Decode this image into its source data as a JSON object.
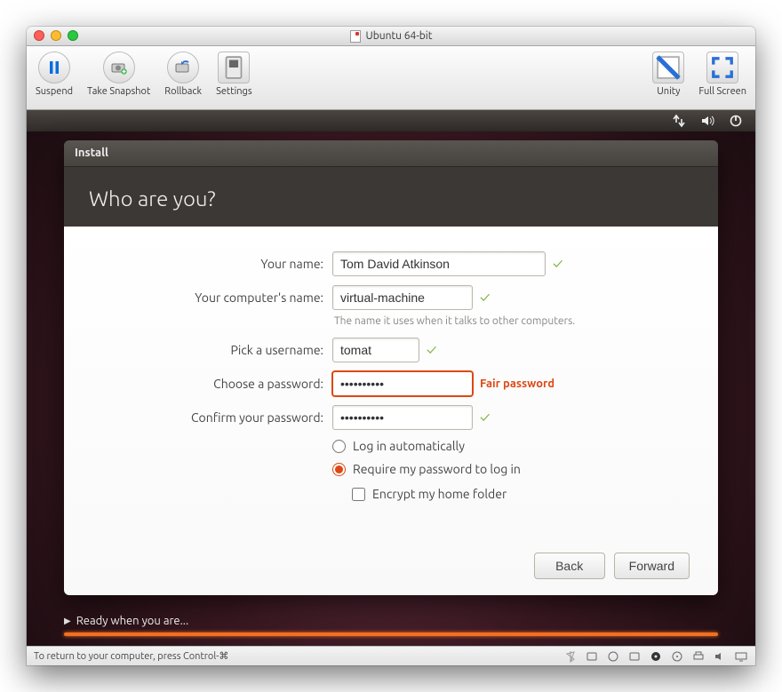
{
  "mac": {
    "title": "Ubuntu 64-bit",
    "toolbar": {
      "suspend": "Suspend",
      "snapshot": "Take Snapshot",
      "rollback": "Rollback",
      "settings": "Settings",
      "unity": "Unity",
      "fullscreen": "Full Screen"
    }
  },
  "installer": {
    "window_title": "Install",
    "heading": "Who are you?",
    "labels": {
      "your_name": "Your name:",
      "computer_name": "Your computer's name:",
      "computer_hint": "The name it uses when it talks to other computers.",
      "pick_username": "Pick a username:",
      "choose_password": "Choose a password:",
      "confirm_password": "Confirm your password:",
      "login_auto": "Log in automatically",
      "require_pw": "Require my password to log in",
      "encrypt_home": "Encrypt my home folder"
    },
    "values": {
      "your_name": "Tom David Atkinson",
      "computer_name": "virtual-machine",
      "username": "tomat",
      "password": "••••••••••",
      "confirm": "••••••••••"
    },
    "password_strength": "Fair password",
    "buttons": {
      "back": "Back",
      "forward": "Forward"
    }
  },
  "progress": {
    "label": "Ready when you are..."
  },
  "statusbar": {
    "hint": "To return to your computer, press Control-⌘"
  }
}
